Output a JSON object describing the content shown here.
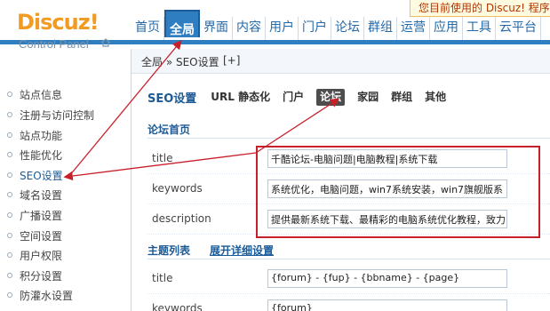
{
  "header": {
    "brand": "Discuz!",
    "subtitle": "Control Panel",
    "banner": "您目前使用的 Discuz! 程序有"
  },
  "nav": [
    {
      "label": "首页"
    },
    {
      "label": "全局",
      "active": true
    },
    {
      "label": "界面"
    },
    {
      "label": "内容"
    },
    {
      "label": "用户"
    },
    {
      "label": "门户"
    },
    {
      "label": "论坛"
    },
    {
      "label": "群组"
    },
    {
      "label": "运营"
    },
    {
      "label": "应用"
    },
    {
      "label": "工具"
    },
    {
      "label": "云平台"
    }
  ],
  "sidebar": {
    "items": [
      {
        "label": "站点信息"
      },
      {
        "label": "注册与访问控制"
      },
      {
        "label": "站点功能"
      },
      {
        "label": "性能优化"
      },
      {
        "label": "SEO设置",
        "active": true
      },
      {
        "label": "域名设置"
      },
      {
        "label": "广播设置"
      },
      {
        "label": "空间设置"
      },
      {
        "label": "用户权限"
      },
      {
        "label": "积分设置"
      },
      {
        "label": "防灌水设置"
      }
    ]
  },
  "breadcrumb": {
    "path": "全局 » SEO设置",
    "add": "[+]"
  },
  "subnav": {
    "title": "SEO设置",
    "tabs": [
      {
        "label": "URL 静态化"
      },
      {
        "label": "门户"
      },
      {
        "label": "论坛",
        "active": true
      },
      {
        "label": "家园"
      },
      {
        "label": "群组"
      },
      {
        "label": "其他"
      }
    ]
  },
  "forum_index": {
    "heading": "论坛首页",
    "rows": [
      {
        "key": "title",
        "value": "千酷论坛-电脑问题|电脑教程|系统下载"
      },
      {
        "key": "keywords",
        "value": "系统优化，电脑问题，win7系统安装，win7旗舰版系"
      },
      {
        "key": "description",
        "value": "提供最新系统下载、最精彩的电脑系统优化教程，致力"
      }
    ]
  },
  "thread_list": {
    "heading": "主题列表",
    "expand_link": "展开详细设置",
    "rows": [
      {
        "key": "title",
        "value": "{forum} - {fup} - {bbname} - {page}"
      },
      {
        "key": "keywords",
        "value": "{forum}"
      }
    ]
  },
  "colors": {
    "accent": "#2f7ec2",
    "brand": "#f29b22",
    "annotation": "#c8202a"
  }
}
